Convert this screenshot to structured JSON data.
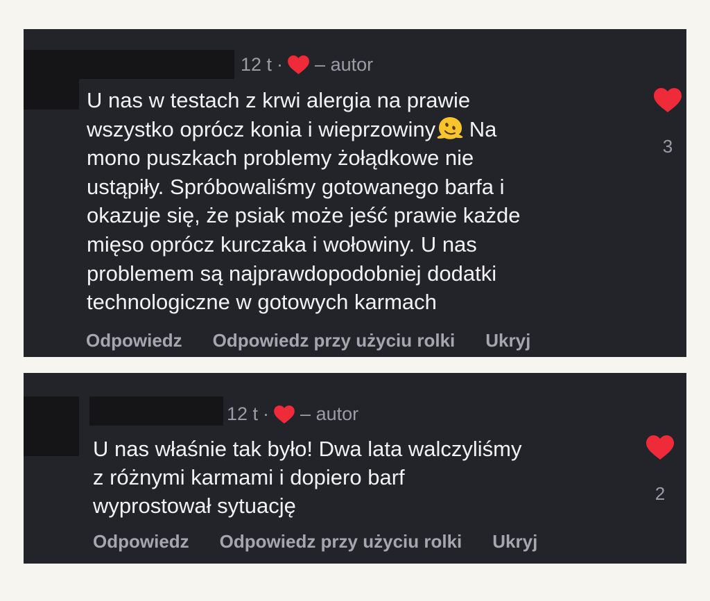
{
  "comments": [
    {
      "time": "12 t",
      "separator": "·",
      "author_tag": "– autor",
      "text_before_emoji": "U nas w testach z krwi alergia na prawie\nwszystko oprócz konia i wieprzowiny",
      "emoji": "melting-face",
      "text_after_emoji": " Na\nmono puszkach problemy żołądkowe nie\nustąpiły. Spróbowaliśmy gotowanego barfa i\nokazuje się, że psiak może jeść prawie każde\nmięso oprócz kurczaka i wołowiny. U nas\nproblemem są najprawdopodobniej dodatki\ntechnologiczne w gotowych karmach",
      "like_count": "3",
      "actions": {
        "reply": "Odpowiedz",
        "reply_reel": "Odpowiedz przy użyciu rolki",
        "hide": "Ukryj"
      }
    },
    {
      "time": "12 t",
      "separator": "·",
      "author_tag": "– autor",
      "text": "U nas właśnie tak było! Dwa lata walczyliśmy\nz różnymi karmami i dopiero barf\nwyprostował sytuację",
      "like_count": "2",
      "actions": {
        "reply": "Odpowiedz",
        "reply_reel": "Odpowiedz przy użyciu rolki",
        "hide": "Ukryj"
      }
    }
  ],
  "colors": {
    "background": "#f6f5f0",
    "card": "#23242a",
    "heart": "#ef2b3a",
    "text": "#f2f2f4",
    "muted": "#9a9ca6"
  },
  "icons": {
    "author_heart": "heart-icon",
    "like": "heart-icon",
    "emoji": "melting-face-emoji-icon"
  }
}
